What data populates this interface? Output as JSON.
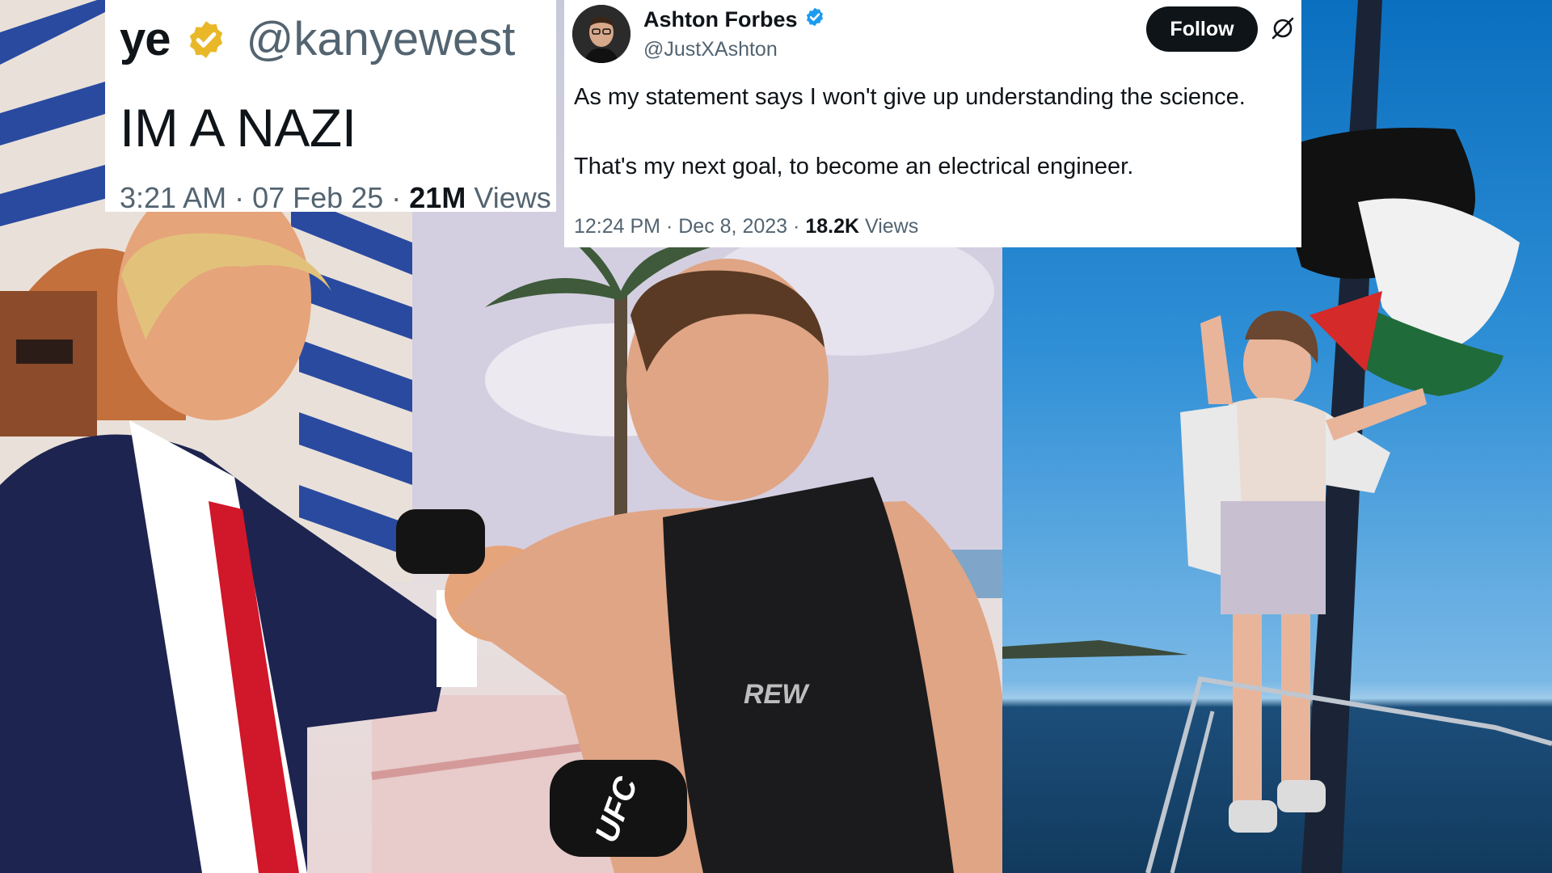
{
  "tweet_ye": {
    "display_name": "ye",
    "handle": "@kanyewest",
    "text": "IM A NAZI",
    "time": "3:21 AM",
    "date": "07 Feb 25",
    "views_count": "21M",
    "views_label": "Views",
    "separator": "·"
  },
  "tweet_ashton": {
    "display_name": "Ashton Forbes",
    "handle": "@JustXAshton",
    "follow_label": "Follow",
    "line1": "As my statement says I won't give up understanding the science.",
    "line2": "That's my next goal, to become an electrical engineer.",
    "time": "12:24 PM",
    "date": "Dec 8, 2023",
    "views_count": "18.2K",
    "views_label": "Views",
    "separator": "·"
  },
  "photo_left": {
    "glove_text": "UFC",
    "shirt_text": "REW"
  },
  "colors": {
    "verified_gold": "#e8b829",
    "verified_blue": "#1d9bf0",
    "text_primary": "#0f1419",
    "text_secondary": "#536471"
  },
  "icons": {
    "verified_gold": "verified-gold-badge-icon",
    "verified_blue": "verified-blue-badge-icon",
    "x_logo": "grok-slash-circle-icon"
  }
}
